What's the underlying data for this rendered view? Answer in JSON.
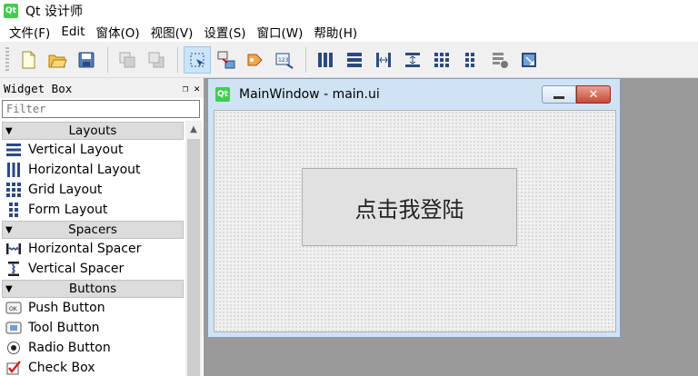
{
  "window": {
    "title": "Qt 设计师",
    "logo_text": "Qt"
  },
  "menubar": [
    {
      "label": "文件(F)"
    },
    {
      "label": "Edit"
    },
    {
      "label": "窗体(O)"
    },
    {
      "label": "视图(V)"
    },
    {
      "label": "设置(S)"
    },
    {
      "label": "窗口(W)"
    },
    {
      "label": "帮助(H)"
    }
  ],
  "toolbar": {
    "buttons": [
      "new-file-icon",
      "open-file-icon",
      "save-icon",
      "send-to-back-icon",
      "bring-to-front-icon",
      "edit-widgets-icon",
      "edit-signals-slots-icon",
      "edit-buddies-icon",
      "edit-tab-order-icon",
      "layout-horizontal-icon",
      "layout-vertical-icon",
      "layout-horizontal-splitter-icon",
      "layout-vertical-splitter-icon",
      "layout-grid-icon",
      "layout-form-icon",
      "break-layout-icon",
      "adjust-size-icon"
    ],
    "active": "edit-widgets-icon"
  },
  "widget_box": {
    "title": "Widget Box",
    "filter_placeholder": "Filter",
    "categories": [
      {
        "label": "Layouts",
        "items": [
          {
            "label": "Vertical Layout",
            "icon": "vertical-layout-icon"
          },
          {
            "label": "Horizontal Layout",
            "icon": "horizontal-layout-icon"
          },
          {
            "label": "Grid Layout",
            "icon": "grid-layout-icon"
          },
          {
            "label": "Form Layout",
            "icon": "form-layout-icon"
          }
        ]
      },
      {
        "label": "Spacers",
        "items": [
          {
            "label": "Horizontal Spacer",
            "icon": "horizontal-spacer-icon"
          },
          {
            "label": "Vertical Spacer",
            "icon": "vertical-spacer-icon"
          }
        ]
      },
      {
        "label": "Buttons",
        "items": [
          {
            "label": "Push Button",
            "icon": "push-button-icon"
          },
          {
            "label": "Tool Button",
            "icon": "tool-button-icon"
          },
          {
            "label": "Radio Button",
            "icon": "radio-button-icon"
          },
          {
            "label": "Check Box",
            "icon": "check-box-icon"
          }
        ]
      }
    ]
  },
  "subwindow": {
    "title": "MainWindow - main.ui",
    "logo_text": "Qt",
    "login_button": "点击我登陆"
  },
  "colors": {
    "accent_active": "#cce4f7",
    "mdi_background": "#9a9a9a",
    "close_red": "#c74a38",
    "qt_green": "#41cd52"
  }
}
